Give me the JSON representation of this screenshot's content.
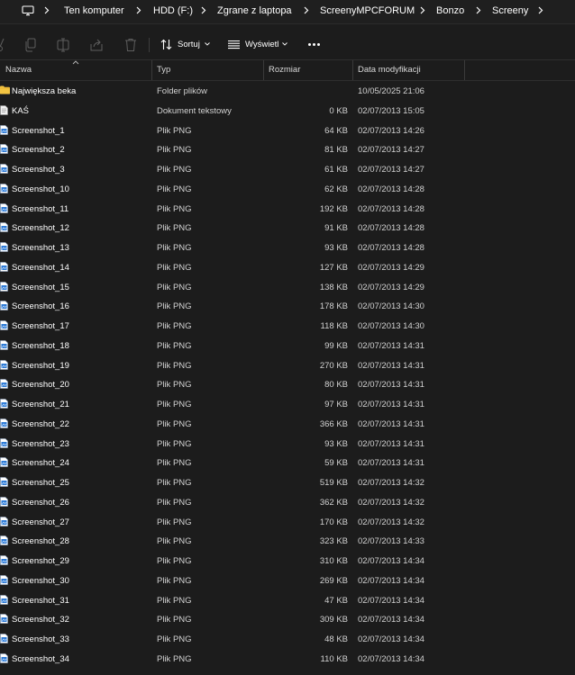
{
  "breadcrumb": [
    "Ten komputer",
    "HDD (F:)",
    "Zgrane z laptopa",
    "ScreenyMPCFORUM",
    "Bonzo",
    "Screeny"
  ],
  "toolbar": {
    "sort_label": "Sortuj",
    "view_label": "Wyświetl"
  },
  "columns": {
    "name": "Nazwa",
    "type": "Typ",
    "size": "Rozmiar",
    "date": "Data modyfikacji"
  },
  "files": [
    {
      "name": "Największa beka",
      "type": "Folder plików",
      "size": "",
      "date": "10/05/2025 21:06",
      "icon": "folder-icon"
    },
    {
      "name": "KAŚ",
      "type": "Dokument tekstowy",
      "size": "0 KB",
      "date": "02/07/2013 15:05",
      "icon": "text-file-icon"
    },
    {
      "name": "Screenshot_1",
      "type": "Plik PNG",
      "size": "64 KB",
      "date": "02/07/2013 14:26",
      "icon": "png-file-icon"
    },
    {
      "name": "Screenshot_2",
      "type": "Plik PNG",
      "size": "81 KB",
      "date": "02/07/2013 14:27",
      "icon": "png-file-icon"
    },
    {
      "name": "Screenshot_3",
      "type": "Plik PNG",
      "size": "61 KB",
      "date": "02/07/2013 14:27",
      "icon": "png-file-icon"
    },
    {
      "name": "Screenshot_10",
      "type": "Plik PNG",
      "size": "62 KB",
      "date": "02/07/2013 14:28",
      "icon": "png-file-icon"
    },
    {
      "name": "Screenshot_11",
      "type": "Plik PNG",
      "size": "192 KB",
      "date": "02/07/2013 14:28",
      "icon": "png-file-icon"
    },
    {
      "name": "Screenshot_12",
      "type": "Plik PNG",
      "size": "91 KB",
      "date": "02/07/2013 14:28",
      "icon": "png-file-icon"
    },
    {
      "name": "Screenshot_13",
      "type": "Plik PNG",
      "size": "93 KB",
      "date": "02/07/2013 14:28",
      "icon": "png-file-icon"
    },
    {
      "name": "Screenshot_14",
      "type": "Plik PNG",
      "size": "127 KB",
      "date": "02/07/2013 14:29",
      "icon": "png-file-icon"
    },
    {
      "name": "Screenshot_15",
      "type": "Plik PNG",
      "size": "138 KB",
      "date": "02/07/2013 14:29",
      "icon": "png-file-icon"
    },
    {
      "name": "Screenshot_16",
      "type": "Plik PNG",
      "size": "178 KB",
      "date": "02/07/2013 14:30",
      "icon": "png-file-icon"
    },
    {
      "name": "Screenshot_17",
      "type": "Plik PNG",
      "size": "118 KB",
      "date": "02/07/2013 14:30",
      "icon": "png-file-icon"
    },
    {
      "name": "Screenshot_18",
      "type": "Plik PNG",
      "size": "99 KB",
      "date": "02/07/2013 14:31",
      "icon": "png-file-icon"
    },
    {
      "name": "Screenshot_19",
      "type": "Plik PNG",
      "size": "270 KB",
      "date": "02/07/2013 14:31",
      "icon": "png-file-icon"
    },
    {
      "name": "Screenshot_20",
      "type": "Plik PNG",
      "size": "80 KB",
      "date": "02/07/2013 14:31",
      "icon": "png-file-icon"
    },
    {
      "name": "Screenshot_21",
      "type": "Plik PNG",
      "size": "97 KB",
      "date": "02/07/2013 14:31",
      "icon": "png-file-icon"
    },
    {
      "name": "Screenshot_22",
      "type": "Plik PNG",
      "size": "366 KB",
      "date": "02/07/2013 14:31",
      "icon": "png-file-icon"
    },
    {
      "name": "Screenshot_23",
      "type": "Plik PNG",
      "size": "93 KB",
      "date": "02/07/2013 14:31",
      "icon": "png-file-icon"
    },
    {
      "name": "Screenshot_24",
      "type": "Plik PNG",
      "size": "59 KB",
      "date": "02/07/2013 14:31",
      "icon": "png-file-icon"
    },
    {
      "name": "Screenshot_25",
      "type": "Plik PNG",
      "size": "519 KB",
      "date": "02/07/2013 14:32",
      "icon": "png-file-icon"
    },
    {
      "name": "Screenshot_26",
      "type": "Plik PNG",
      "size": "362 KB",
      "date": "02/07/2013 14:32",
      "icon": "png-file-icon"
    },
    {
      "name": "Screenshot_27",
      "type": "Plik PNG",
      "size": "170 KB",
      "date": "02/07/2013 14:32",
      "icon": "png-file-icon"
    },
    {
      "name": "Screenshot_28",
      "type": "Plik PNG",
      "size": "323 KB",
      "date": "02/07/2013 14:33",
      "icon": "png-file-icon"
    },
    {
      "name": "Screenshot_29",
      "type": "Plik PNG",
      "size": "310 KB",
      "date": "02/07/2013 14:34",
      "icon": "png-file-icon"
    },
    {
      "name": "Screenshot_30",
      "type": "Plik PNG",
      "size": "269 KB",
      "date": "02/07/2013 14:34",
      "icon": "png-file-icon"
    },
    {
      "name": "Screenshot_31",
      "type": "Plik PNG",
      "size": "47 KB",
      "date": "02/07/2013 14:34",
      "icon": "png-file-icon"
    },
    {
      "name": "Screenshot_32",
      "type": "Plik PNG",
      "size": "309 KB",
      "date": "02/07/2013 14:34",
      "icon": "png-file-icon"
    },
    {
      "name": "Screenshot_33",
      "type": "Plik PNG",
      "size": "48 KB",
      "date": "02/07/2013 14:34",
      "icon": "png-file-icon"
    },
    {
      "name": "Screenshot_34",
      "type": "Plik PNG",
      "size": "110 KB",
      "date": "02/07/2013 14:34",
      "icon": "png-file-icon"
    }
  ]
}
